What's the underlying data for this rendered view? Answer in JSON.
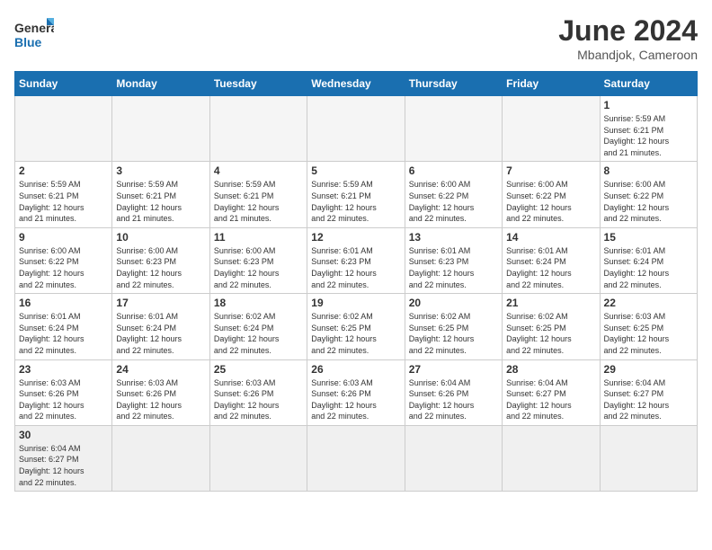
{
  "header": {
    "logo_general": "General",
    "logo_blue": "Blue",
    "title": "June 2024",
    "subtitle": "Mbandjok, Cameroon"
  },
  "days_of_week": [
    "Sunday",
    "Monday",
    "Tuesday",
    "Wednesday",
    "Thursday",
    "Friday",
    "Saturday"
  ],
  "weeks": [
    [
      {
        "day": "",
        "info": ""
      },
      {
        "day": "",
        "info": ""
      },
      {
        "day": "",
        "info": ""
      },
      {
        "day": "",
        "info": ""
      },
      {
        "day": "",
        "info": ""
      },
      {
        "day": "",
        "info": ""
      },
      {
        "day": "1",
        "info": "Sunrise: 5:59 AM\nSunset: 6:21 PM\nDaylight: 12 hours\nand 21 minutes."
      }
    ],
    [
      {
        "day": "2",
        "info": "Sunrise: 5:59 AM\nSunset: 6:21 PM\nDaylight: 12 hours\nand 21 minutes."
      },
      {
        "day": "3",
        "info": "Sunrise: 5:59 AM\nSunset: 6:21 PM\nDaylight: 12 hours\nand 21 minutes."
      },
      {
        "day": "4",
        "info": "Sunrise: 5:59 AM\nSunset: 6:21 PM\nDaylight: 12 hours\nand 21 minutes."
      },
      {
        "day": "5",
        "info": "Sunrise: 5:59 AM\nSunset: 6:21 PM\nDaylight: 12 hours\nand 22 minutes."
      },
      {
        "day": "6",
        "info": "Sunrise: 6:00 AM\nSunset: 6:22 PM\nDaylight: 12 hours\nand 22 minutes."
      },
      {
        "day": "7",
        "info": "Sunrise: 6:00 AM\nSunset: 6:22 PM\nDaylight: 12 hours\nand 22 minutes."
      },
      {
        "day": "8",
        "info": "Sunrise: 6:00 AM\nSunset: 6:22 PM\nDaylight: 12 hours\nand 22 minutes."
      }
    ],
    [
      {
        "day": "9",
        "info": "Sunrise: 6:00 AM\nSunset: 6:22 PM\nDaylight: 12 hours\nand 22 minutes."
      },
      {
        "day": "10",
        "info": "Sunrise: 6:00 AM\nSunset: 6:23 PM\nDaylight: 12 hours\nand 22 minutes."
      },
      {
        "day": "11",
        "info": "Sunrise: 6:00 AM\nSunset: 6:23 PM\nDaylight: 12 hours\nand 22 minutes."
      },
      {
        "day": "12",
        "info": "Sunrise: 6:01 AM\nSunset: 6:23 PM\nDaylight: 12 hours\nand 22 minutes."
      },
      {
        "day": "13",
        "info": "Sunrise: 6:01 AM\nSunset: 6:23 PM\nDaylight: 12 hours\nand 22 minutes."
      },
      {
        "day": "14",
        "info": "Sunrise: 6:01 AM\nSunset: 6:24 PM\nDaylight: 12 hours\nand 22 minutes."
      },
      {
        "day": "15",
        "info": "Sunrise: 6:01 AM\nSunset: 6:24 PM\nDaylight: 12 hours\nand 22 minutes."
      }
    ],
    [
      {
        "day": "16",
        "info": "Sunrise: 6:01 AM\nSunset: 6:24 PM\nDaylight: 12 hours\nand 22 minutes."
      },
      {
        "day": "17",
        "info": "Sunrise: 6:01 AM\nSunset: 6:24 PM\nDaylight: 12 hours\nand 22 minutes."
      },
      {
        "day": "18",
        "info": "Sunrise: 6:02 AM\nSunset: 6:24 PM\nDaylight: 12 hours\nand 22 minutes."
      },
      {
        "day": "19",
        "info": "Sunrise: 6:02 AM\nSunset: 6:25 PM\nDaylight: 12 hours\nand 22 minutes."
      },
      {
        "day": "20",
        "info": "Sunrise: 6:02 AM\nSunset: 6:25 PM\nDaylight: 12 hours\nand 22 minutes."
      },
      {
        "day": "21",
        "info": "Sunrise: 6:02 AM\nSunset: 6:25 PM\nDaylight: 12 hours\nand 22 minutes."
      },
      {
        "day": "22",
        "info": "Sunrise: 6:03 AM\nSunset: 6:25 PM\nDaylight: 12 hours\nand 22 minutes."
      }
    ],
    [
      {
        "day": "23",
        "info": "Sunrise: 6:03 AM\nSunset: 6:26 PM\nDaylight: 12 hours\nand 22 minutes."
      },
      {
        "day": "24",
        "info": "Sunrise: 6:03 AM\nSunset: 6:26 PM\nDaylight: 12 hours\nand 22 minutes."
      },
      {
        "day": "25",
        "info": "Sunrise: 6:03 AM\nSunset: 6:26 PM\nDaylight: 12 hours\nand 22 minutes."
      },
      {
        "day": "26",
        "info": "Sunrise: 6:03 AM\nSunset: 6:26 PM\nDaylight: 12 hours\nand 22 minutes."
      },
      {
        "day": "27",
        "info": "Sunrise: 6:04 AM\nSunset: 6:26 PM\nDaylight: 12 hours\nand 22 minutes."
      },
      {
        "day": "28",
        "info": "Sunrise: 6:04 AM\nSunset: 6:27 PM\nDaylight: 12 hours\nand 22 minutes."
      },
      {
        "day": "29",
        "info": "Sunrise: 6:04 AM\nSunset: 6:27 PM\nDaylight: 12 hours\nand 22 minutes."
      }
    ],
    [
      {
        "day": "30",
        "info": "Sunrise: 6:04 AM\nSunset: 6:27 PM\nDaylight: 12 hours\nand 22 minutes."
      },
      {
        "day": "",
        "info": ""
      },
      {
        "day": "",
        "info": ""
      },
      {
        "day": "",
        "info": ""
      },
      {
        "day": "",
        "info": ""
      },
      {
        "day": "",
        "info": ""
      },
      {
        "day": "",
        "info": ""
      }
    ]
  ]
}
